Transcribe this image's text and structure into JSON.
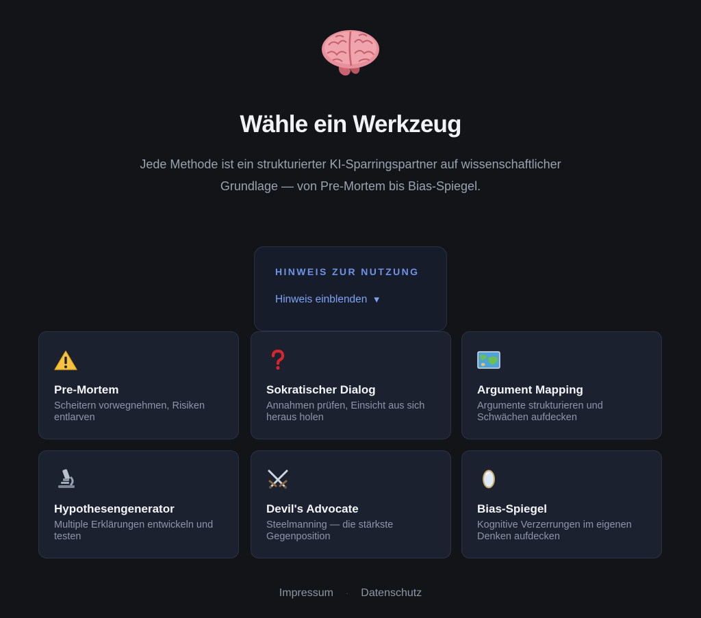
{
  "header": {
    "logo_icon": "brain-icon",
    "title": "Wähle ein Werkzeug",
    "subtitle": "Jede Methode ist ein strukturierter KI-Sparringspartner auf wissenschaftlicher Grundlage — von Pre-Mortem bis Bias-Spiegel."
  },
  "hint": {
    "heading": "HINWEIS ZUR NUTZUNG",
    "toggle_label": "Hinweis einblenden",
    "toggle_arrow": "▼"
  },
  "tools": [
    {
      "icon": "warning-icon",
      "title": "Pre-Mortem",
      "description": "Scheitern vorwegnehmen, Risiken entlarven"
    },
    {
      "icon": "question-mark-icon",
      "title": "Sokratischer Dialog",
      "description": "Annahmen prüfen, Einsicht aus sich heraus holen"
    },
    {
      "icon": "map-icon",
      "title": "Argument Mapping",
      "description": "Argumente strukturieren und Schwächen aufdecken"
    },
    {
      "icon": "microscope-icon",
      "title": "Hypothesengenerator",
      "description": "Multiple Erklärungen entwickeln und testen"
    },
    {
      "icon": "crossed-swords-icon",
      "title": "Devil's Advocate",
      "description": "Steelmanning — die stärkste Gegenposition"
    },
    {
      "icon": "mirror-icon",
      "title": "Bias-Spiegel",
      "description": "Kognitive Verzerrungen im eigenen Denken aufdecken"
    }
  ],
  "footer": {
    "impressum": "Impressum",
    "separator": "·",
    "datenschutz": "Datenschutz"
  },
  "colors": {
    "background": "#131418",
    "card_background": "#1c2130",
    "accent": "#7ea3f5"
  }
}
